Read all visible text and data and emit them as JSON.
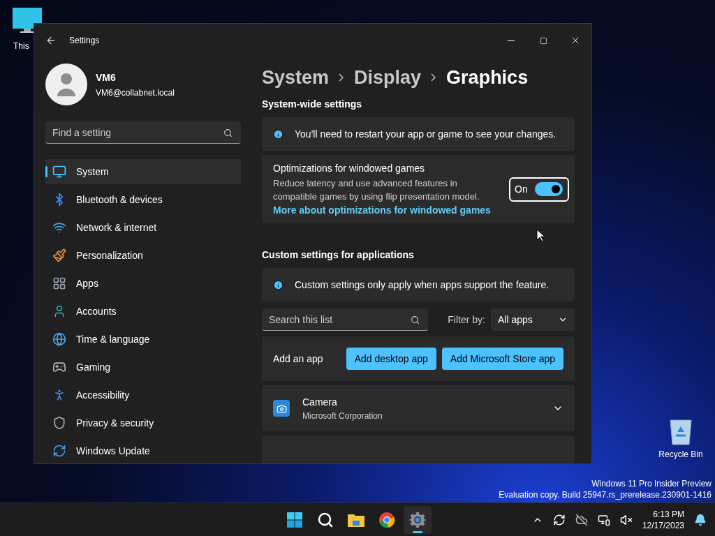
{
  "desktop": {
    "icons": [
      {
        "label": "This"
      },
      {
        "label": "Recycle Bin"
      }
    ],
    "notice": [
      "Windows 11 Pro Insider Preview",
      "Evaluation copy. Build 25947.rs_prerelease.230901-1416"
    ]
  },
  "window": {
    "title": "Settings",
    "user": {
      "name": "VM6",
      "email": "VM6@collabnet.local"
    },
    "search": {
      "placeholder": "Find a setting"
    },
    "nav": [
      {
        "label": "System",
        "selected": true
      },
      {
        "label": "Bluetooth & devices",
        "selected": false
      },
      {
        "label": "Network & internet",
        "selected": false
      },
      {
        "label": "Personalization",
        "selected": false
      },
      {
        "label": "Apps",
        "selected": false
      },
      {
        "label": "Accounts",
        "selected": false
      },
      {
        "label": "Time & language",
        "selected": false
      },
      {
        "label": "Gaming",
        "selected": false
      },
      {
        "label": "Accessibility",
        "selected": false
      },
      {
        "label": "Privacy & security",
        "selected": false
      },
      {
        "label": "Windows Update",
        "selected": false
      }
    ],
    "breadcrumb": [
      "System",
      "Display",
      "Graphics"
    ],
    "system_wide": {
      "heading": "System-wide settings",
      "info": "You'll need to restart your app or game to see your changes.",
      "optimization": {
        "title": "Optimizations for windowed games",
        "description": "Reduce latency and use advanced features in compatible games by using flip presentation model.",
        "link": "More about optimizations for windowed games",
        "toggle": {
          "label": "On",
          "on": true
        }
      }
    },
    "custom": {
      "heading": "Custom settings for applications",
      "info": "Custom settings only apply when apps support the feature.",
      "search": {
        "placeholder": "Search this list"
      },
      "filter": {
        "label": "Filter by:",
        "value": "All apps"
      },
      "add_app": {
        "label": "Add an app",
        "buttons": [
          "Add desktop app",
          "Add Microsoft Store app"
        ]
      },
      "apps": [
        {
          "name": "Camera",
          "publisher": "Microsoft Corporation",
          "expanded": false
        }
      ]
    }
  },
  "taskbar": {
    "apps": [
      {
        "kind": "start",
        "selected": false
      },
      {
        "kind": "search",
        "selected": false
      },
      {
        "kind": "explorer",
        "selected": false
      },
      {
        "kind": "browser",
        "selected": false
      },
      {
        "kind": "settings",
        "selected": true
      }
    ],
    "clock": {
      "time": "6:13 PM",
      "date": "12/17/2023"
    }
  }
}
